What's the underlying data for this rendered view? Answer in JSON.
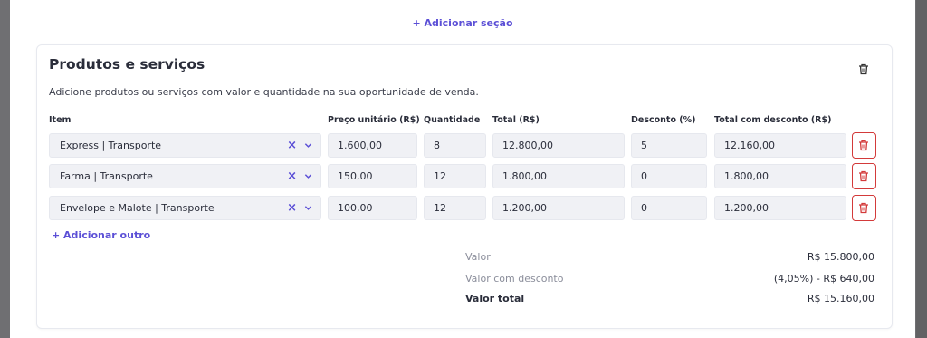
{
  "add_section_label": "+ Adicionar seção",
  "card": {
    "title": "Produtos e serviços",
    "description": "Adicione produtos ou serviços com valor e quantidade na sua oportunidade de venda."
  },
  "table": {
    "headers": {
      "item": "Item",
      "unit_price": "Preço unitário (R$)",
      "quantity": "Quantidade",
      "total": "Total (R$)",
      "discount": "Desconto (%)",
      "total_discount": "Total com desconto (R$)"
    },
    "rows": [
      {
        "item": "Express | Transporte",
        "unit_price": "1.600,00",
        "quantity": "8",
        "total": "12.800,00",
        "discount": "5",
        "total_discount": "12.160,00"
      },
      {
        "item": "Farma | Transporte",
        "unit_price": "150,00",
        "quantity": "12",
        "total": "1.800,00",
        "discount": "0",
        "total_discount": "1.800,00"
      },
      {
        "item": "Envelope e Malote | Transporte",
        "unit_price": "100,00",
        "quantity": "12",
        "total": "1.200,00",
        "discount": "0",
        "total_discount": "1.200,00"
      }
    ],
    "clear_glyph": "×",
    "add_other_label": "+  Adicionar outro"
  },
  "summary": {
    "value_label": "Valor",
    "value": "R$ 15.800,00",
    "discount_label": "Valor com desconto",
    "discount_value": "(4,05%) - R$ 640,00",
    "total_label": "Valor total",
    "total_value": "R$ 15.160,00"
  },
  "colors": {
    "accent": "#5b4fd6",
    "danger": "#d33a3a",
    "backdrop": "#6f6f72"
  },
  "icons": {
    "card_delete": "trash-icon",
    "row_delete": "trash-icon",
    "dropdown": "chevron-down-icon",
    "clear": "close-icon"
  }
}
